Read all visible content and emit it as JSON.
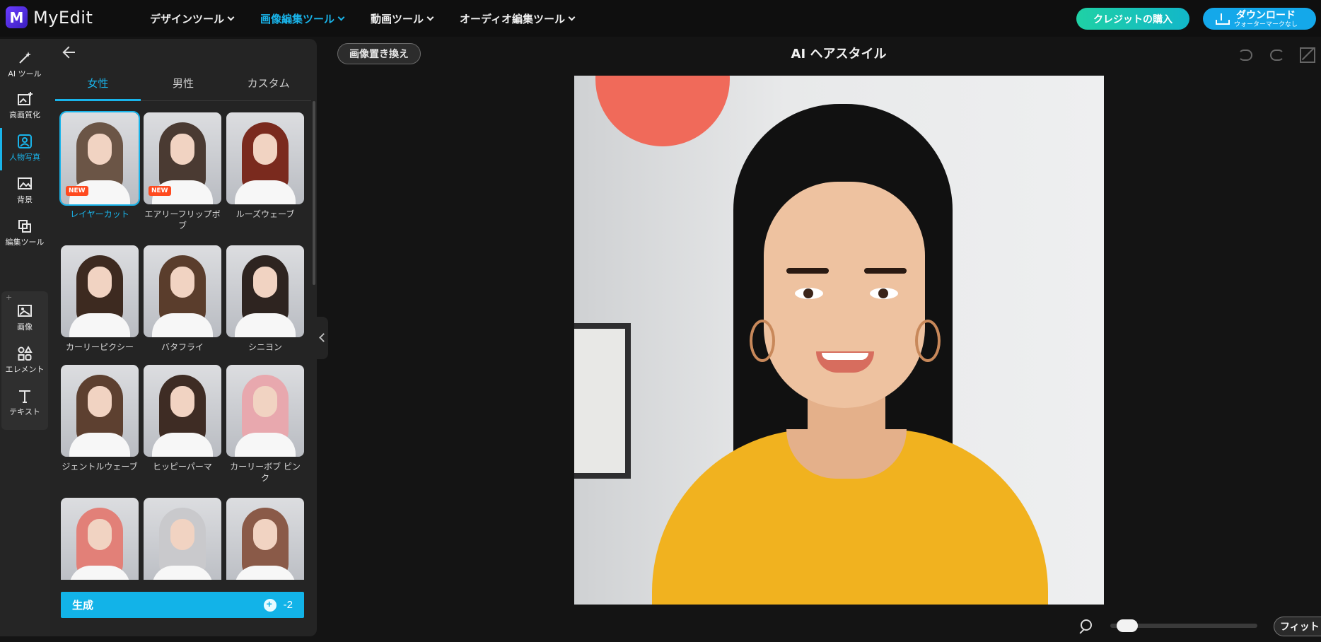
{
  "app": {
    "logo_letter": "M",
    "name": "MyEdit"
  },
  "nav": [
    {
      "label": "デザインツール",
      "active": false
    },
    {
      "label": "画像編集ツール",
      "active": true
    },
    {
      "label": "動画ツール",
      "active": false
    },
    {
      "label": "オーディオ編集ツール",
      "active": false
    }
  ],
  "header": {
    "credit_button": "クレジットの購入",
    "download_button": "ダウンロード",
    "download_sub": "ウォーターマークなし"
  },
  "rail": [
    {
      "label": "AI ツール",
      "icon": "magic-wand-icon"
    },
    {
      "label": "高画質化",
      "icon": "enhance-icon"
    },
    {
      "label": "人物写真",
      "icon": "portrait-icon",
      "active": true
    },
    {
      "label": "背景",
      "icon": "background-icon"
    },
    {
      "label": "編集ツール",
      "icon": "edit-tools-icon"
    },
    {
      "label": "画像",
      "icon": "image-icon"
    },
    {
      "label": "エレメント",
      "icon": "elements-icon"
    },
    {
      "label": "テキスト",
      "icon": "text-icon"
    }
  ],
  "rail_group_plus": "+",
  "tabs": [
    {
      "label": "女性",
      "active": true
    },
    {
      "label": "男性",
      "active": false
    },
    {
      "label": "カスタム",
      "active": false
    }
  ],
  "styles": [
    {
      "label": "レイヤーカット",
      "badge": "NEW",
      "selected": true,
      "hair": "#6b5546"
    },
    {
      "label": "エアリーフリップボブ",
      "badge": "NEW",
      "selected": false,
      "hair": "#4a3a32"
    },
    {
      "label": "ルーズウェーブ",
      "badge": "",
      "selected": false,
      "hair": "#7a2a1e"
    },
    {
      "label": "カーリーピクシー",
      "badge": "",
      "selected": false,
      "hair": "#3d2a20"
    },
    {
      "label": "バタフライ",
      "badge": "",
      "selected": false,
      "hair": "#5a3d2c"
    },
    {
      "label": "シニヨン",
      "badge": "",
      "selected": false,
      "hair": "#2e2420"
    },
    {
      "label": "ジェントルウェーブ",
      "badge": "",
      "selected": false,
      "hair": "#5d4030"
    },
    {
      "label": "ヒッピーパーマ",
      "badge": "",
      "selected": false,
      "hair": "#3e2c24"
    },
    {
      "label": "カーリーボブ ピンク",
      "badge": "",
      "selected": false,
      "hair": "#e8a8ae"
    },
    {
      "label": "",
      "badge": "",
      "selected": false,
      "hair": "#e28078"
    },
    {
      "label": "",
      "badge": "",
      "selected": false,
      "hair": "#c9c9cc"
    },
    {
      "label": "",
      "badge": "",
      "selected": false,
      "hair": "#8a5a48"
    }
  ],
  "generate": {
    "label": "生成",
    "cost": "-2"
  },
  "canvas": {
    "replace_button": "画像置き換え",
    "title": "AI ヘアスタイル"
  },
  "zoom": {
    "fit_button": "フィット",
    "level": 0.05
  },
  "colors": {
    "accent": "#19b4ea",
    "credit_gradient_start": "#1fd1a5",
    "download": "#14a8ea",
    "new_badge": "#ff4a1f"
  }
}
